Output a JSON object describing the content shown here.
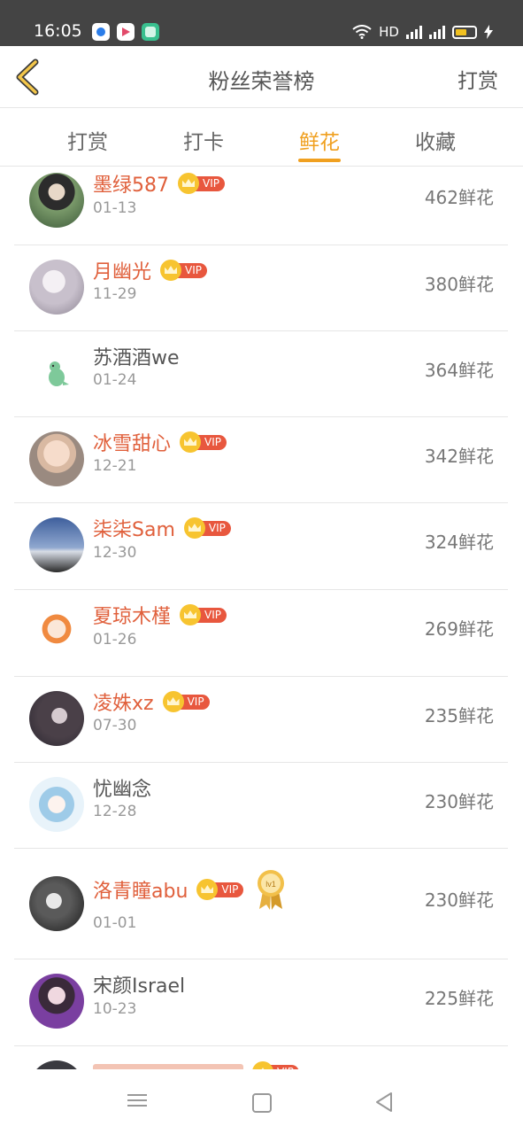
{
  "status_bar": {
    "time": "16:05",
    "network_label": "HD",
    "app_icons": [
      "browser-icon",
      "video-icon",
      "chat-icon"
    ],
    "battery_color": "#f0c020"
  },
  "header": {
    "title": "粉丝荣誉榜",
    "action_label": "打赏",
    "back_icon": "chevron-left-icon"
  },
  "tabs": [
    {
      "label": "打赏",
      "active": false
    },
    {
      "label": "打卡",
      "active": false
    },
    {
      "label": "鲜花",
      "active": true
    },
    {
      "label": "收藏",
      "active": false
    }
  ],
  "accent_color": "#f0a020",
  "vip_label": "VIP",
  "medal_text": "lv1",
  "rows": [
    {
      "name": "墨绿587",
      "date": "01-13",
      "count": "462鲜花",
      "vip": true
    },
    {
      "name": "月幽光",
      "date": "11-29",
      "count": "380鲜花",
      "vip": true
    },
    {
      "name": "苏酒酒we",
      "date": "01-24",
      "count": "364鲜花",
      "vip": false
    },
    {
      "name": "冰雪甜心",
      "date": "12-21",
      "count": "342鲜花",
      "vip": true
    },
    {
      "name": "柒柒Sam",
      "date": "12-30",
      "count": "324鲜花",
      "vip": true
    },
    {
      "name": "夏琼木槿",
      "date": "01-26",
      "count": "269鲜花",
      "vip": true
    },
    {
      "name": "凌姝xz",
      "date": "07-30",
      "count": "235鲜花",
      "vip": true
    },
    {
      "name": "忧幽念",
      "date": "12-28",
      "count": "230鲜花",
      "vip": false
    },
    {
      "name": "洛青瞳abu",
      "date": "01-01",
      "count": "230鲜花",
      "vip": true,
      "medal": true
    },
    {
      "name": "宋颜Israel",
      "date": "10-23",
      "count": "225鲜花",
      "vip": false
    }
  ],
  "nav_bar": [
    "menu-icon",
    "home-icon",
    "back-icon"
  ]
}
